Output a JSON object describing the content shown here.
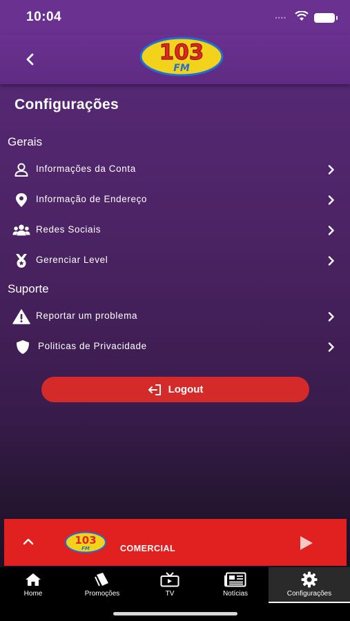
{
  "status_bar": {
    "time": "10:04",
    "signal_text": "••••"
  },
  "header": {
    "logo_text": "103 FM"
  },
  "page": {
    "title": "Configurações"
  },
  "sections": {
    "gerais": {
      "title": "Gerais",
      "items": [
        {
          "label": "Informações da Conta",
          "icon": "user-icon"
        },
        {
          "label": "Informação de Endereço",
          "icon": "map-pin-icon"
        },
        {
          "label": "Redes Sociais",
          "icon": "users-group-icon"
        },
        {
          "label": "Gerenciar Level",
          "icon": "medal-icon"
        }
      ]
    },
    "suporte": {
      "title": "Suporte",
      "items": [
        {
          "label": "Reportar um problema",
          "icon": "warning-icon"
        },
        {
          "label": "Politicas de Privacidade",
          "icon": "shield-icon"
        }
      ]
    }
  },
  "logout": {
    "label": "Logout"
  },
  "player": {
    "station": "COMERCIAL",
    "logo_text": "103 FM"
  },
  "tabs": [
    {
      "label": "Home",
      "icon": "home-icon",
      "active": false
    },
    {
      "label": "Promoções",
      "icon": "tag-icon",
      "active": false
    },
    {
      "label": "TV",
      "icon": "tv-icon",
      "active": false
    },
    {
      "label": "Notícias",
      "icon": "newspaper-icon",
      "active": false
    },
    {
      "label": "Configurações",
      "icon": "gear-icon",
      "active": true
    }
  ],
  "colors": {
    "header": "#6a3190",
    "logout_button": "#d42a2a",
    "player_bar": "#e0211f",
    "tab_bar": "#000000"
  }
}
